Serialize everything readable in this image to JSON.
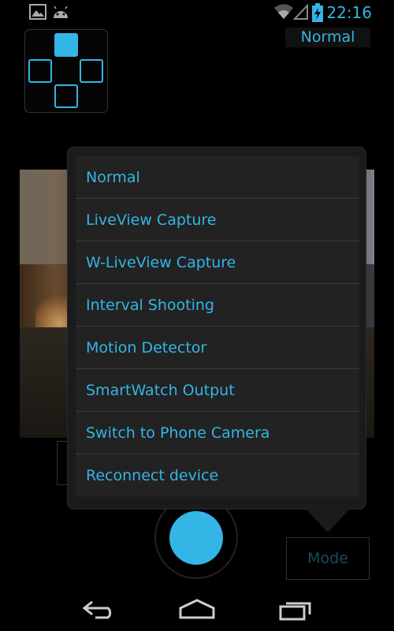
{
  "status_bar": {
    "time": "22:16",
    "icons": [
      "gallery-icon",
      "android-icon",
      "wifi-icon",
      "signal-icon",
      "battery-charging-icon"
    ]
  },
  "top": {
    "mode_label": "Normal"
  },
  "menu": {
    "items": [
      {
        "label": "Normal"
      },
      {
        "label": "LiveView Capture"
      },
      {
        "label": "W-LiveView Capture"
      },
      {
        "label": "Interval Shooting"
      },
      {
        "label": "Motion Detector"
      },
      {
        "label": "SmartWatch Output"
      },
      {
        "label": "Switch to Phone Camera"
      },
      {
        "label": "Reconnect device"
      }
    ]
  },
  "bottom": {
    "mode_button_label": "Mode"
  },
  "navbar": {
    "icons": [
      "back-icon",
      "home-icon",
      "recents-icon"
    ]
  },
  "colors": {
    "accent": "#33b5e5",
    "background": "#000000",
    "menu_bg": "#222222"
  }
}
